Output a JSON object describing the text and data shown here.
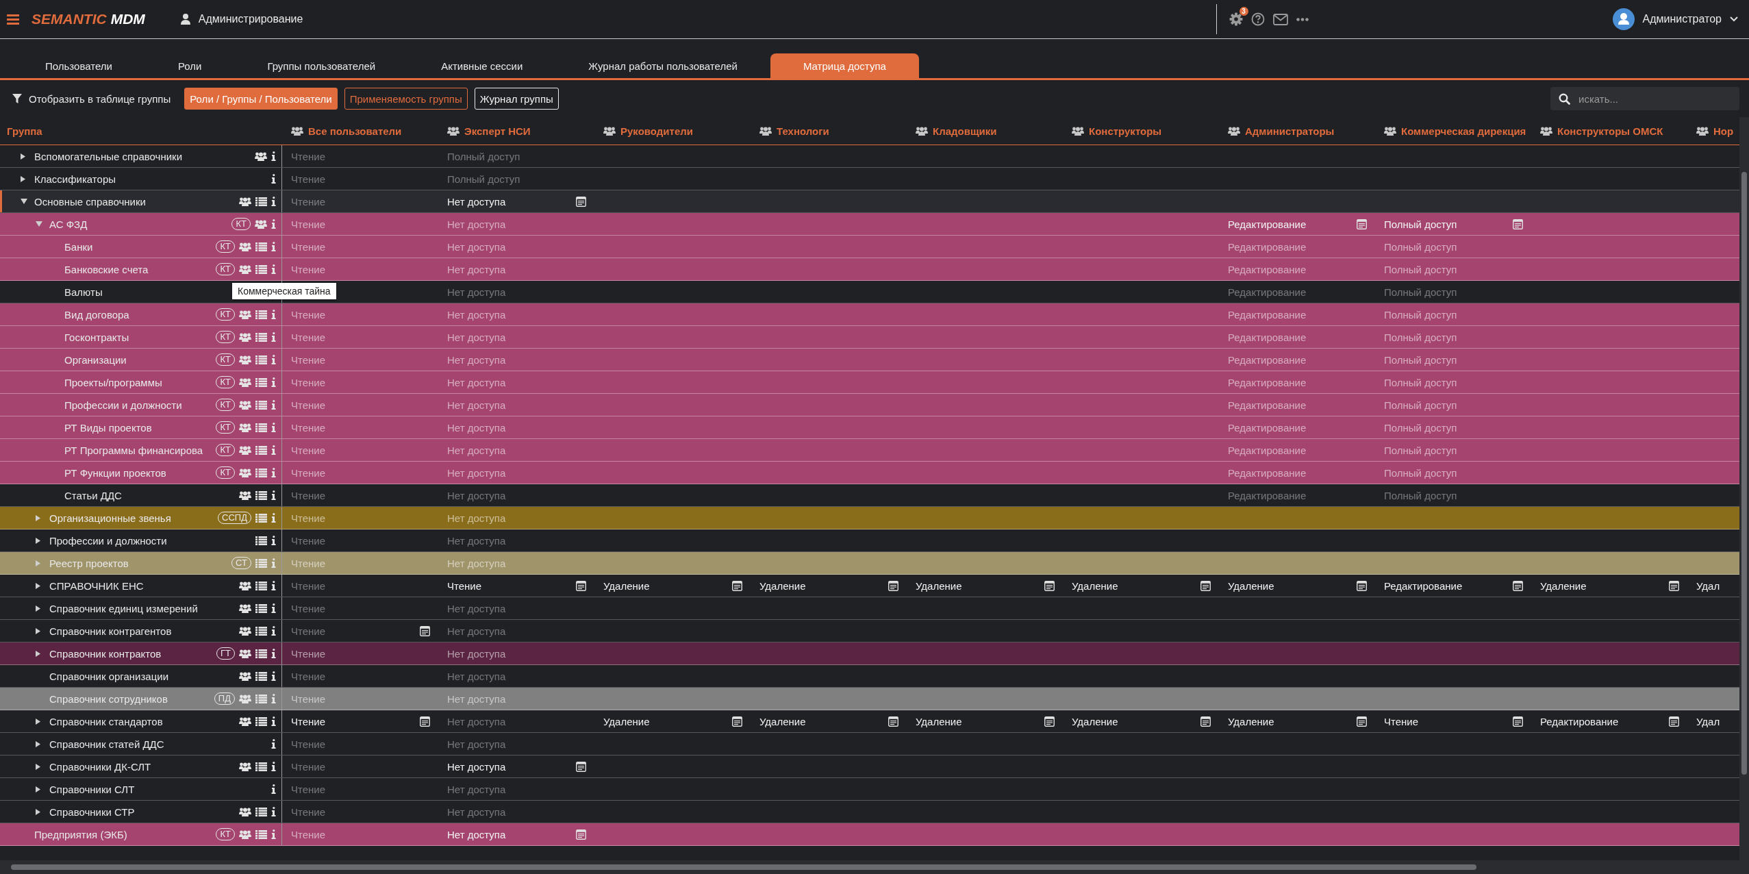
{
  "header": {
    "brand_primary": "SEMANTIC",
    "brand_secondary": "MDM",
    "section": "Администрирование",
    "notifications": "3",
    "user": "Администратор"
  },
  "tabs": [
    {
      "label": "Пользователи",
      "selected": false
    },
    {
      "label": "Роли",
      "selected": false
    },
    {
      "label": "Группы пользователей",
      "selected": false
    },
    {
      "label": "Активные сессии",
      "selected": false
    },
    {
      "label": "Журнал работы пользователей",
      "selected": false
    },
    {
      "label": "Матрица доступа",
      "selected": true
    }
  ],
  "toolbar": {
    "filter_label": "Отобразить в таблице группы",
    "buttons": [
      {
        "label": "Роли / Группы / Пользователи",
        "selected": true,
        "kind": "accent"
      },
      {
        "label": "Применяемость группы",
        "selected": false,
        "kind": "accent"
      },
      {
        "label": "Журнал группы",
        "selected": false,
        "kind": "plain"
      }
    ],
    "search": {
      "placeholder": "искать..."
    }
  },
  "table": {
    "group_header": "Группа",
    "columns": [
      {
        "label": "Все пользователи"
      },
      {
        "label": "Эксперт НСИ"
      },
      {
        "label": "Руководители"
      },
      {
        "label": "Технологи"
      },
      {
        "label": "Кладовщики"
      },
      {
        "label": "Конструкторы"
      },
      {
        "label": "Администраторы"
      },
      {
        "label": "Коммерческая дирекция"
      },
      {
        "label": "Конструкторы ОМСК"
      },
      {
        "label": "Нор"
      }
    ],
    "rows": [
      {
        "name": "Вспомогательные справочники",
        "expanded": false,
        "selected": false,
        "users": true,
        "list": false,
        "info": true,
        "cells": [
          {
            "text": "Чтение",
            "explicit": false,
            "note": false
          },
          {
            "text": "Полный доступ",
            "explicit": false,
            "note": false
          }
        ]
      },
      {
        "name": "Классификаторы",
        "expanded": false,
        "selected": false,
        "users": false,
        "list": false,
        "info": true,
        "cells": [
          {
            "text": "Чтение",
            "explicit": false,
            "note": false
          },
          {
            "text": "Полный доступ",
            "explicit": false,
            "note": false
          }
        ]
      },
      {
        "name": "Основные справочники",
        "expanded": true,
        "selected": true,
        "users": true,
        "list": true,
        "info": true,
        "cells": [
          {
            "text": "Чтение",
            "explicit": false,
            "note": false
          },
          {
            "text": "Нет доступа",
            "explicit": true,
            "note": true
          }
        ],
        "children": [
          {
            "name": "АС ФЗД",
            "expanded": true,
            "selected": false,
            "badge": "КТ",
            "color": "#a5456f",
            "users": true,
            "list": false,
            "info": true,
            "cells": [
              {
                "text": "Чтение",
                "explicit": false,
                "note": false
              },
              {
                "text": "Нет доступа",
                "explicit": false,
                "note": false
              },
              {},
              {},
              {},
              {},
              {
                "text": "Редактирование",
                "explicit": true,
                "note": true
              },
              {
                "text": "Полный доступ",
                "explicit": true,
                "note": true
              }
            ],
            "children": [
              {
                "name": "Банки",
                "selected": false,
                "badge": "КТ",
                "color": "#a5456f",
                "users": true,
                "list": true,
                "info": true,
                "cells": [
                  {
                    "text": "Чтение",
                    "explicit": false,
                    "note": false
                  },
                  {
                    "text": "Нет доступа",
                    "explicit": false,
                    "note": false
                  },
                  {},
                  {},
                  {},
                  {},
                  {
                    "text": "Редактирование",
                    "explicit": false,
                    "note": false
                  },
                  {
                    "text": "Полный доступ",
                    "explicit": false,
                    "note": false
                  }
                ]
              },
              {
                "name": "Банковские счета",
                "selected": false,
                "badge": "КТ",
                "color": "#a5456f",
                "users": true,
                "list": true,
                "info": true,
                "cells": [
                  {
                    "text": "Чтение",
                    "explicit": false,
                    "note": false
                  },
                  {
                    "text": "Нет доступа",
                    "explicit": false,
                    "note": false
                  },
                  {},
                  {},
                  {},
                  {},
                  {
                    "text": "Редактирование",
                    "explicit": false,
                    "note": false
                  },
                  {
                    "text": "Полный доступ",
                    "explicit": false,
                    "note": false
                  }
                ]
              },
              {
                "name": "Валюты",
                "selected": false,
                "users": false,
                "list": false,
                "info": false,
                "tooltip": "Коммерческая тайна",
                "cells": [
                  {},
                  {
                    "text": "Нет доступа",
                    "explicit": false,
                    "note": false
                  },
                  {},
                  {},
                  {},
                  {},
                  {
                    "text": "Редактирование",
                    "explicit": false,
                    "note": false
                  },
                  {
                    "text": "Полный доступ",
                    "explicit": false,
                    "note": false
                  }
                ]
              },
              {
                "name": "Вид договора",
                "selected": false,
                "badge": "КТ",
                "color": "#a5456f",
                "users": true,
                "list": true,
                "info": true,
                "cells": [
                  {
                    "text": "Чтение",
                    "explicit": false,
                    "note": false
                  },
                  {
                    "text": "Нет доступа",
                    "explicit": false,
                    "note": false
                  },
                  {},
                  {},
                  {},
                  {},
                  {
                    "text": "Редактирование",
                    "explicit": false,
                    "note": false
                  },
                  {
                    "text": "Полный доступ",
                    "explicit": false,
                    "note": false
                  }
                ]
              },
              {
                "name": "Госконтракты",
                "selected": false,
                "badge": "КТ",
                "color": "#a5456f",
                "users": true,
                "list": true,
                "info": true,
                "cells": [
                  {
                    "text": "Чтение",
                    "explicit": false,
                    "note": false
                  },
                  {
                    "text": "Нет доступа",
                    "explicit": false,
                    "note": false
                  },
                  {},
                  {},
                  {},
                  {},
                  {
                    "text": "Редактирование",
                    "explicit": false,
                    "note": false
                  },
                  {
                    "text": "Полный доступ",
                    "explicit": false,
                    "note": false
                  }
                ]
              },
              {
                "name": "Организации",
                "selected": false,
                "badge": "КТ",
                "color": "#a5456f",
                "users": true,
                "list": true,
                "info": true,
                "cells": [
                  {
                    "text": "Чтение",
                    "explicit": false,
                    "note": false
                  },
                  {
                    "text": "Нет доступа",
                    "explicit": false,
                    "note": false
                  },
                  {},
                  {},
                  {},
                  {},
                  {
                    "text": "Редактирование",
                    "explicit": false,
                    "note": false
                  },
                  {
                    "text": "Полный доступ",
                    "explicit": false,
                    "note": false
                  }
                ]
              },
              {
                "name": "Проекты/программы",
                "selected": false,
                "badge": "КТ",
                "color": "#a5456f",
                "users": true,
                "list": true,
                "info": true,
                "cells": [
                  {
                    "text": "Чтение",
                    "explicit": false,
                    "note": false
                  },
                  {
                    "text": "Нет доступа",
                    "explicit": false,
                    "note": false
                  },
                  {},
                  {},
                  {},
                  {},
                  {
                    "text": "Редактирование",
                    "explicit": false,
                    "note": false
                  },
                  {
                    "text": "Полный доступ",
                    "explicit": false,
                    "note": false
                  }
                ]
              },
              {
                "name": "Профессии и должности",
                "selected": false,
                "badge": "КТ",
                "color": "#a5456f",
                "users": true,
                "list": true,
                "info": true,
                "cells": [
                  {
                    "text": "Чтение",
                    "explicit": false,
                    "note": false
                  },
                  {
                    "text": "Нет доступа",
                    "explicit": false,
                    "note": false
                  },
                  {},
                  {},
                  {},
                  {},
                  {
                    "text": "Редактирование",
                    "explicit": false,
                    "note": false
                  },
                  {
                    "text": "Полный доступ",
                    "explicit": false,
                    "note": false
                  }
                ]
              },
              {
                "name": "РТ Виды проектов",
                "selected": false,
                "badge": "КТ",
                "color": "#a5456f",
                "users": true,
                "list": true,
                "info": true,
                "cells": [
                  {
                    "text": "Чтение",
                    "explicit": false,
                    "note": false
                  },
                  {
                    "text": "Нет доступа",
                    "explicit": false,
                    "note": false
                  },
                  {},
                  {},
                  {},
                  {},
                  {
                    "text": "Редактирование",
                    "explicit": false,
                    "note": false
                  },
                  {
                    "text": "Полный доступ",
                    "explicit": false,
                    "note": false
                  }
                ]
              },
              {
                "name": "РТ Программы финансирова",
                "selected": false,
                "badge": "КТ",
                "color": "#a5456f",
                "users": true,
                "list": true,
                "info": true,
                "cells": [
                  {
                    "text": "Чтение",
                    "explicit": false,
                    "note": false
                  },
                  {
                    "text": "Нет доступа",
                    "explicit": false,
                    "note": false
                  },
                  {},
                  {},
                  {},
                  {},
                  {
                    "text": "Редактирование",
                    "explicit": false,
                    "note": false
                  },
                  {
                    "text": "Полный доступ",
                    "explicit": false,
                    "note": false
                  }
                ]
              },
              {
                "name": "РТ Функции проектов",
                "selected": false,
                "badge": "КТ",
                "color": "#a5456f",
                "users": true,
                "list": true,
                "info": true,
                "cells": [
                  {
                    "text": "Чтение",
                    "explicit": false,
                    "note": false
                  },
                  {
                    "text": "Нет доступа",
                    "explicit": false,
                    "note": false
                  },
                  {},
                  {},
                  {},
                  {},
                  {
                    "text": "Редактирование",
                    "explicit": false,
                    "note": false
                  },
                  {
                    "text": "Полный доступ",
                    "explicit": false,
                    "note": false
                  }
                ]
              },
              {
                "name": "Статьи ДДС",
                "selected": false,
                "users": true,
                "list": true,
                "info": true,
                "cells": [
                  {
                    "text": "Чтение",
                    "explicit": false,
                    "note": false
                  },
                  {
                    "text": "Нет доступа",
                    "explicit": false,
                    "note": false
                  },
                  {},
                  {},
                  {},
                  {},
                  {
                    "text": "Редактирование",
                    "explicit": false,
                    "note": false
                  },
                  {
                    "text": "Полный доступ",
                    "explicit": false,
                    "note": false
                  }
                ]
              }
            ]
          },
          {
            "name": "Организационные звенья",
            "expanded": false,
            "selected": false,
            "badge": "ССПД",
            "color": "#8a6d1a",
            "users": false,
            "list": true,
            "info": true,
            "cells": [
              {
                "text": "Чтение",
                "explicit": false,
                "note": false
              },
              {
                "text": "Нет доступа",
                "explicit": false,
                "note": false
              }
            ]
          },
          {
            "name": "Профессии и должности",
            "expanded": false,
            "selected": false,
            "users": false,
            "list": true,
            "info": true,
            "cells": [
              {
                "text": "Чтение",
                "explicit": false,
                "note": false
              },
              {
                "text": "Нет доступа",
                "explicit": false,
                "note": false
              }
            ]
          },
          {
            "name": "Реестр проектов",
            "expanded": false,
            "selected": false,
            "badge": "СТ",
            "color": "#a0946a",
            "users": false,
            "list": true,
            "info": true,
            "cells": [
              {
                "text": "Чтение",
                "explicit": false,
                "note": false
              },
              {
                "text": "Нет доступа",
                "explicit": false,
                "note": false
              }
            ]
          },
          {
            "name": "СПРАВОЧНИК ЕНС",
            "expanded": false,
            "selected": false,
            "users": true,
            "list": true,
            "info": true,
            "cells": [
              {
                "text": "Чтение",
                "explicit": false,
                "note": false
              },
              {
                "text": "Чтение",
                "explicit": true,
                "note": true
              },
              {
                "text": "Удаление",
                "explicit": true,
                "note": true
              },
              {
                "text": "Удаление",
                "explicit": true,
                "note": true
              },
              {
                "text": "Удаление",
                "explicit": true,
                "note": true
              },
              {
                "text": "Удаление",
                "explicit": true,
                "note": true
              },
              {
                "text": "Удаление",
                "explicit": true,
                "note": true
              },
              {
                "text": "Редактирование",
                "explicit": true,
                "note": true
              },
              {
                "text": "Удаление",
                "explicit": true,
                "note": true
              },
              {
                "text": "Удал",
                "explicit": true,
                "note": false
              }
            ]
          },
          {
            "name": "Справочник единиц измерений",
            "expanded": false,
            "selected": false,
            "users": true,
            "list": true,
            "info": true,
            "cells": [
              {
                "text": "Чтение",
                "explicit": false,
                "note": false
              },
              {
                "text": "Нет доступа",
                "explicit": false,
                "note": false
              }
            ]
          },
          {
            "name": "Справочник контрагентов",
            "expanded": false,
            "selected": false,
            "users": true,
            "list": true,
            "info": true,
            "cells": [
              {
                "text": "Чтение",
                "explicit": false,
                "note": true
              },
              {
                "text": "Нет доступа",
                "explicit": false,
                "note": false
              }
            ]
          },
          {
            "name": "Справочник контрактов",
            "expanded": false,
            "selected": false,
            "badge": "ГТ",
            "color": "#5a2442",
            "users": true,
            "list": true,
            "info": true,
            "cells": [
              {
                "text": "Чтение",
                "explicit": false,
                "note": false
              },
              {
                "text": "Нет доступа",
                "explicit": false,
                "note": false
              }
            ]
          },
          {
            "name": "Справочник организации",
            "selected": false,
            "users": true,
            "list": true,
            "info": true,
            "cells": [
              {
                "text": "Чтение",
                "explicit": false,
                "note": false
              },
              {
                "text": "Нет доступа",
                "explicit": false,
                "note": false
              }
            ]
          },
          {
            "name": "Справочник сотрудников",
            "selected": false,
            "badge": "ПД",
            "color": "#808080",
            "users": true,
            "list": true,
            "info": true,
            "cells": [
              {
                "text": "Чтение",
                "explicit": false,
                "note": false
              },
              {
                "text": "Нет доступа",
                "explicit": false,
                "note": false
              }
            ]
          },
          {
            "name": "Справочник стандартов",
            "expanded": false,
            "selected": false,
            "users": true,
            "list": true,
            "info": true,
            "cells": [
              {
                "text": "Чтение",
                "explicit": true,
                "note": true
              },
              {
                "text": "Нет доступа",
                "explicit": false,
                "note": false
              },
              {
                "text": "Удаление",
                "explicit": true,
                "note": true
              },
              {
                "text": "Удаление",
                "explicit": true,
                "note": true
              },
              {
                "text": "Удаление",
                "explicit": true,
                "note": true
              },
              {
                "text": "Удаление",
                "explicit": true,
                "note": true
              },
              {
                "text": "Удаление",
                "explicit": true,
                "note": true
              },
              {
                "text": "Чтение",
                "explicit": true,
                "note": true
              },
              {
                "text": "Редактирование",
                "explicit": true,
                "note": true
              },
              {
                "text": "Удал",
                "explicit": true,
                "note": false
              }
            ]
          },
          {
            "name": "Справочник статей ДДС",
            "expanded": false,
            "selected": false,
            "users": false,
            "list": false,
            "info": true,
            "cells": [
              {
                "text": "Чтение",
                "explicit": false,
                "note": false
              },
              {
                "text": "Нет доступа",
                "explicit": false,
                "note": false
              }
            ]
          },
          {
            "name": "Справочники ДК-СЛТ",
            "expanded": false,
            "selected": false,
            "users": true,
            "list": true,
            "info": true,
            "cells": [
              {
                "text": "Чтение",
                "explicit": false,
                "note": false
              },
              {
                "text": "Нет доступа",
                "explicit": true,
                "note": true
              }
            ]
          },
          {
            "name": "Справочники СЛТ",
            "expanded": false,
            "selected": false,
            "users": false,
            "list": false,
            "info": true,
            "cells": [
              {
                "text": "Чтение",
                "explicit": false,
                "note": false
              },
              {
                "text": "Нет доступа",
                "explicit": false,
                "note": false
              }
            ]
          },
          {
            "name": "Справочники СТР",
            "expanded": false,
            "selected": false,
            "users": true,
            "list": true,
            "info": true,
            "cells": [
              {
                "text": "Чтение",
                "explicit": false,
                "note": false
              },
              {
                "text": "Нет доступа",
                "explicit": false,
                "note": false
              }
            ]
          }
        ]
      },
      {
        "name": "Предприятия (ЭКБ)",
        "selected": false,
        "badge": "КТ",
        "color": "#a5456f",
        "users": true,
        "list": true,
        "info": true,
        "cells": [
          {
            "text": "Чтение",
            "explicit": false,
            "note": false
          },
          {
            "text": "Нет доступа",
            "explicit": true,
            "note": true
          }
        ]
      }
    ]
  }
}
